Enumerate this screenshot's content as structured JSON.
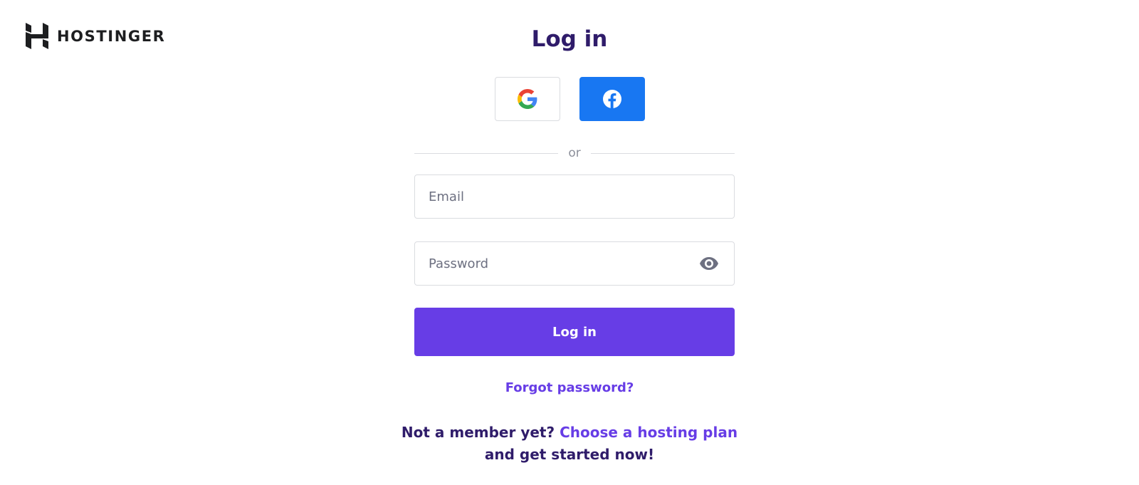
{
  "brand": {
    "name": "HOSTINGER",
    "logo_icon": "hostinger-h-logo-icon"
  },
  "header": {
    "title": "Log in"
  },
  "social": {
    "google_icon": "google-g-icon",
    "facebook_icon": "facebook-f-icon"
  },
  "divider": {
    "label": "or"
  },
  "form": {
    "email_placeholder": "Email",
    "email_value": "",
    "password_placeholder": "Password",
    "password_value": "",
    "password_toggle_icon": "eye-icon",
    "submit_label": "Log in"
  },
  "links": {
    "forgot_password": "Forgot password?",
    "signup_prefix": "Not a member yet?",
    "signup_link": "Choose a hosting plan",
    "signup_suffix": "and get started now!"
  },
  "colors": {
    "primary": "#673de6",
    "title": "#2f1c6a",
    "facebook": "#1877f2"
  }
}
